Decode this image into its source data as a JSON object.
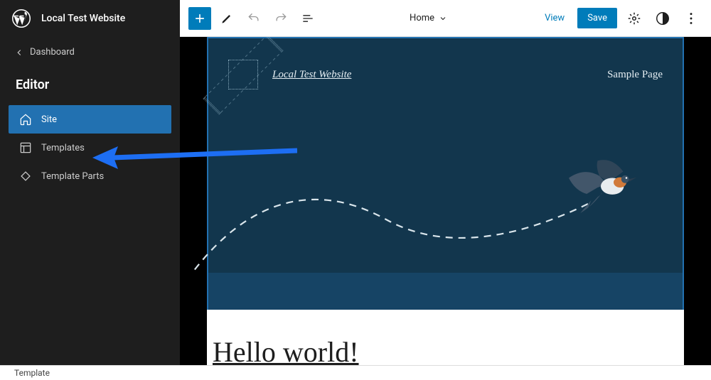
{
  "sidebar": {
    "site_title": "Local Test Website",
    "back_label": "Dashboard",
    "section_label": "Editor",
    "nav": [
      {
        "label": "Site",
        "icon": "home-icon",
        "active": true
      },
      {
        "label": "Templates",
        "icon": "layout-icon",
        "active": false
      },
      {
        "label": "Template Parts",
        "icon": "diamond-icon",
        "active": false
      }
    ]
  },
  "toolbar": {
    "doc_label": "Home",
    "view_label": "View",
    "save_label": "Save"
  },
  "canvas": {
    "brand_text": "Local Test Website",
    "nav_link": "Sample Page",
    "post_title": "Hello world!"
  },
  "footer": {
    "breadcrumb": "Template"
  },
  "colors": {
    "accent": "#007cba",
    "sidebar_bg": "#1e1e1e",
    "hero_bg": "#12364d",
    "arrow": "#1d6ef3"
  }
}
